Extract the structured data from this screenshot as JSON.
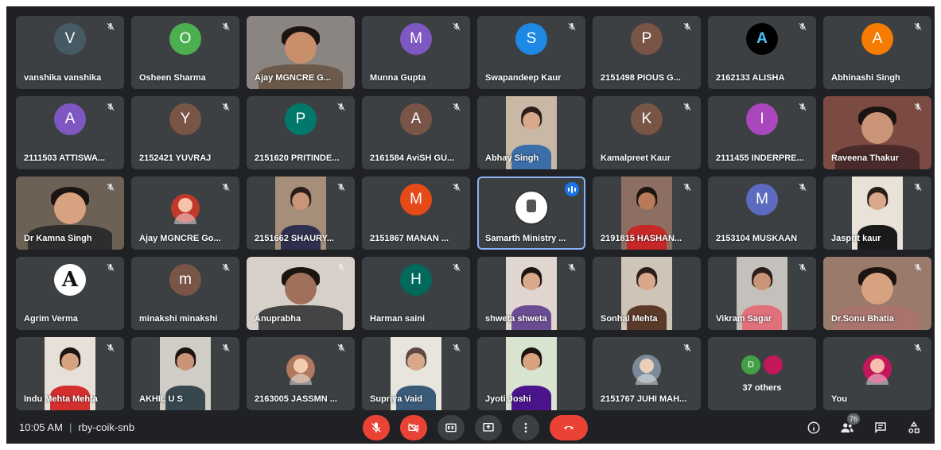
{
  "meeting": {
    "time": "10:05 AM",
    "code": "rby-coik-snb",
    "participant_count": "76"
  },
  "colors": {
    "background": "#202124",
    "tile": "#3c4043",
    "speaking_outline": "#8ab4f8",
    "end_call": "#ea4335",
    "speaking_badge": "#1a73e8"
  },
  "participants": [
    {
      "name": "vanshika vanshika",
      "kind": "initial",
      "initial": "V",
      "color": "#455a64",
      "muted": true
    },
    {
      "name": "Osheen Sharma",
      "kind": "initial",
      "initial": "O",
      "color": "#4caf50",
      "muted": true
    },
    {
      "name": "Ajay MGNCRE G...",
      "kind": "video",
      "skin": "#c98f6a",
      "hair": "#1b1410",
      "shirt": "#6b5a4b",
      "bg": "#8a8580",
      "muted": false
    },
    {
      "name": "Munna Gupta",
      "kind": "initial",
      "initial": "M",
      "color": "#7e57c2",
      "muted": true
    },
    {
      "name": "Swapandeep Kaur",
      "kind": "initial",
      "initial": "S",
      "color": "#1e88e5",
      "muted": true
    },
    {
      "name": "2151498 PIOUS G...",
      "kind": "initial",
      "initial": "P",
      "color": "#795548",
      "muted": true
    },
    {
      "name": "2162133 ALISHA",
      "kind": "logo-dark",
      "initial": "A",
      "color": "#000000",
      "muted": true
    },
    {
      "name": "Abhinashi Singh",
      "kind": "initial",
      "initial": "A",
      "color": "#f57c00",
      "muted": true
    },
    {
      "name": "2111503 ATTISWA...",
      "kind": "initial",
      "initial": "A",
      "color": "#7e57c2",
      "muted": true
    },
    {
      "name": "2152421 YUVRAJ",
      "kind": "initial",
      "initial": "Y",
      "color": "#795548",
      "muted": true
    },
    {
      "name": "2151620 PRITINDE...",
      "kind": "initial",
      "initial": "P",
      "color": "#00796b",
      "muted": true
    },
    {
      "name": "2161584 AviSH GU...",
      "kind": "initial",
      "initial": "A",
      "color": "#795548",
      "muted": true
    },
    {
      "name": "Abhay Singh",
      "kind": "video-narrow",
      "skin": "#d9a88a",
      "hair": "#2b1e18",
      "shirt": "#3b6ea8",
      "bg": "#c9b8a5",
      "muted": false
    },
    {
      "name": "Kamalpreet Kaur",
      "kind": "initial",
      "initial": "K",
      "color": "#795548",
      "muted": true
    },
    {
      "name": "2111455 INDERPRE...",
      "kind": "initial",
      "initial": "I",
      "color": "#ab47bc",
      "muted": true
    },
    {
      "name": "Raveena Thakur",
      "kind": "video",
      "skin": "#c99478",
      "hair": "#1b1410",
      "shirt": "#4a2a2a",
      "bg": "#7b4a42",
      "muted": true
    },
    {
      "name": "Dr Kamna Singh",
      "kind": "video",
      "skin": "#d6a27f",
      "hair": "#1b1410",
      "shirt": "#2d2d2d",
      "bg": "#6d6155",
      "muted": true
    },
    {
      "name": "Ajay MGNCRE Go...",
      "kind": "photo-avatar",
      "color": "#c0392b",
      "muted": true
    },
    {
      "name": "2151662 SHAURY...",
      "kind": "video-narrow",
      "skin": "#c99478",
      "hair": "#2b1e18",
      "shirt": "#2f2f4f",
      "bg": "#a58e7a",
      "muted": true
    },
    {
      "name": "2151867 MANAN ...",
      "kind": "initial",
      "initial": "M",
      "color": "#e64a19",
      "muted": true
    },
    {
      "name": "Samarth Ministry ...",
      "kind": "logo",
      "muted": false,
      "speaking": true
    },
    {
      "name": "2191815 HASHAN...",
      "kind": "video-narrow",
      "skin": "#b97a5a",
      "hair": "#1b1410",
      "shirt": "#c62828",
      "bg": "#8d6e63",
      "muted": true
    },
    {
      "name": "2153104 MUSKAAN",
      "kind": "initial",
      "initial": "M",
      "color": "#5c6bc0",
      "muted": true
    },
    {
      "name": "Jasprit kaur",
      "kind": "video-narrow",
      "skin": "#d9a88a",
      "hair": "#2b1e18",
      "shirt": "#1a1a1a",
      "bg": "#e8e2d8",
      "muted": true
    },
    {
      "name": "Agrim Verma",
      "kind": "logo-letter",
      "initial": "A",
      "color": "#ffffff",
      "muted": true
    },
    {
      "name": "minakshi minakshi",
      "kind": "initial",
      "initial": "m",
      "color": "#795548",
      "muted": true
    },
    {
      "name": "Anuprabha",
      "kind": "video",
      "skin": "#a0705a",
      "hair": "#1b1410",
      "shirt": "#444444",
      "bg": "#d6d0c8",
      "muted": true
    },
    {
      "name": "Harman saini",
      "kind": "initial",
      "initial": "H",
      "color": "#00695c",
      "muted": true
    },
    {
      "name": "shweta shweta",
      "kind": "video-narrow",
      "skin": "#d9a88a",
      "hair": "#1b1410",
      "shirt": "#6a4c93",
      "bg": "#e0d6cf",
      "muted": true
    },
    {
      "name": "Sonhal Mehta",
      "kind": "video-narrow",
      "skin": "#d9a88a",
      "hair": "#2b1e18",
      "shirt": "#5b3a29",
      "bg": "#cfc4b8",
      "muted": false
    },
    {
      "name": "Vikram Sagar",
      "kind": "video-narrow",
      "skin": "#c99478",
      "hair": "#2b1e18",
      "shirt": "#e0707a",
      "bg": "#c4c0bc",
      "muted": true
    },
    {
      "name": "Dr.Sonu Bhatia",
      "kind": "video",
      "skin": "#d6a27f",
      "hair": "#1b1410",
      "shirt": "#a9746e",
      "bg": "#9a7a6a",
      "muted": true
    },
    {
      "name": "Indu Mehta Mehta",
      "kind": "video-narrow",
      "skin": "#d6a27f",
      "hair": "#1b1410",
      "shirt": "#d32f2f",
      "bg": "#e6e0d8",
      "muted": true
    },
    {
      "name": "AKHIL U S",
      "kind": "video-narrow",
      "skin": "#c99478",
      "hair": "#1b1410",
      "shirt": "#37474f",
      "bg": "#d0ccc6",
      "muted": true
    },
    {
      "name": "2163005 JASSMN ...",
      "kind": "photo-avatar",
      "color": "#b0785e",
      "muted": true
    },
    {
      "name": "Supriya Vaid",
      "kind": "video-narrow",
      "skin": "#d9a88a",
      "hair": "#5a4a40",
      "shirt": "#3a5a7a",
      "bg": "#e8e4de",
      "muted": true
    },
    {
      "name": "Jyoti Joshi",
      "kind": "video-narrow",
      "skin": "#d6a27f",
      "hair": "#1b1410",
      "shirt": "#4a148c",
      "bg": "#d8e4d0",
      "muted": false
    },
    {
      "name": "2151767 JUHI MAH...",
      "kind": "photo-avatar",
      "color": "#7a8a9a",
      "muted": true
    },
    {
      "name": "others",
      "kind": "others",
      "label": "37 others",
      "initial": "D",
      "color": "#43a047",
      "muted": false
    },
    {
      "name": "You",
      "kind": "photo-avatar",
      "color": "#c2185b",
      "muted": true
    }
  ],
  "controls": {
    "mic_label": "Turn on microphone",
    "camera_label": "Turn on camera",
    "captions_label": "CC",
    "present_label": "Present now",
    "more_label": "More options",
    "end_label": "Leave call"
  }
}
